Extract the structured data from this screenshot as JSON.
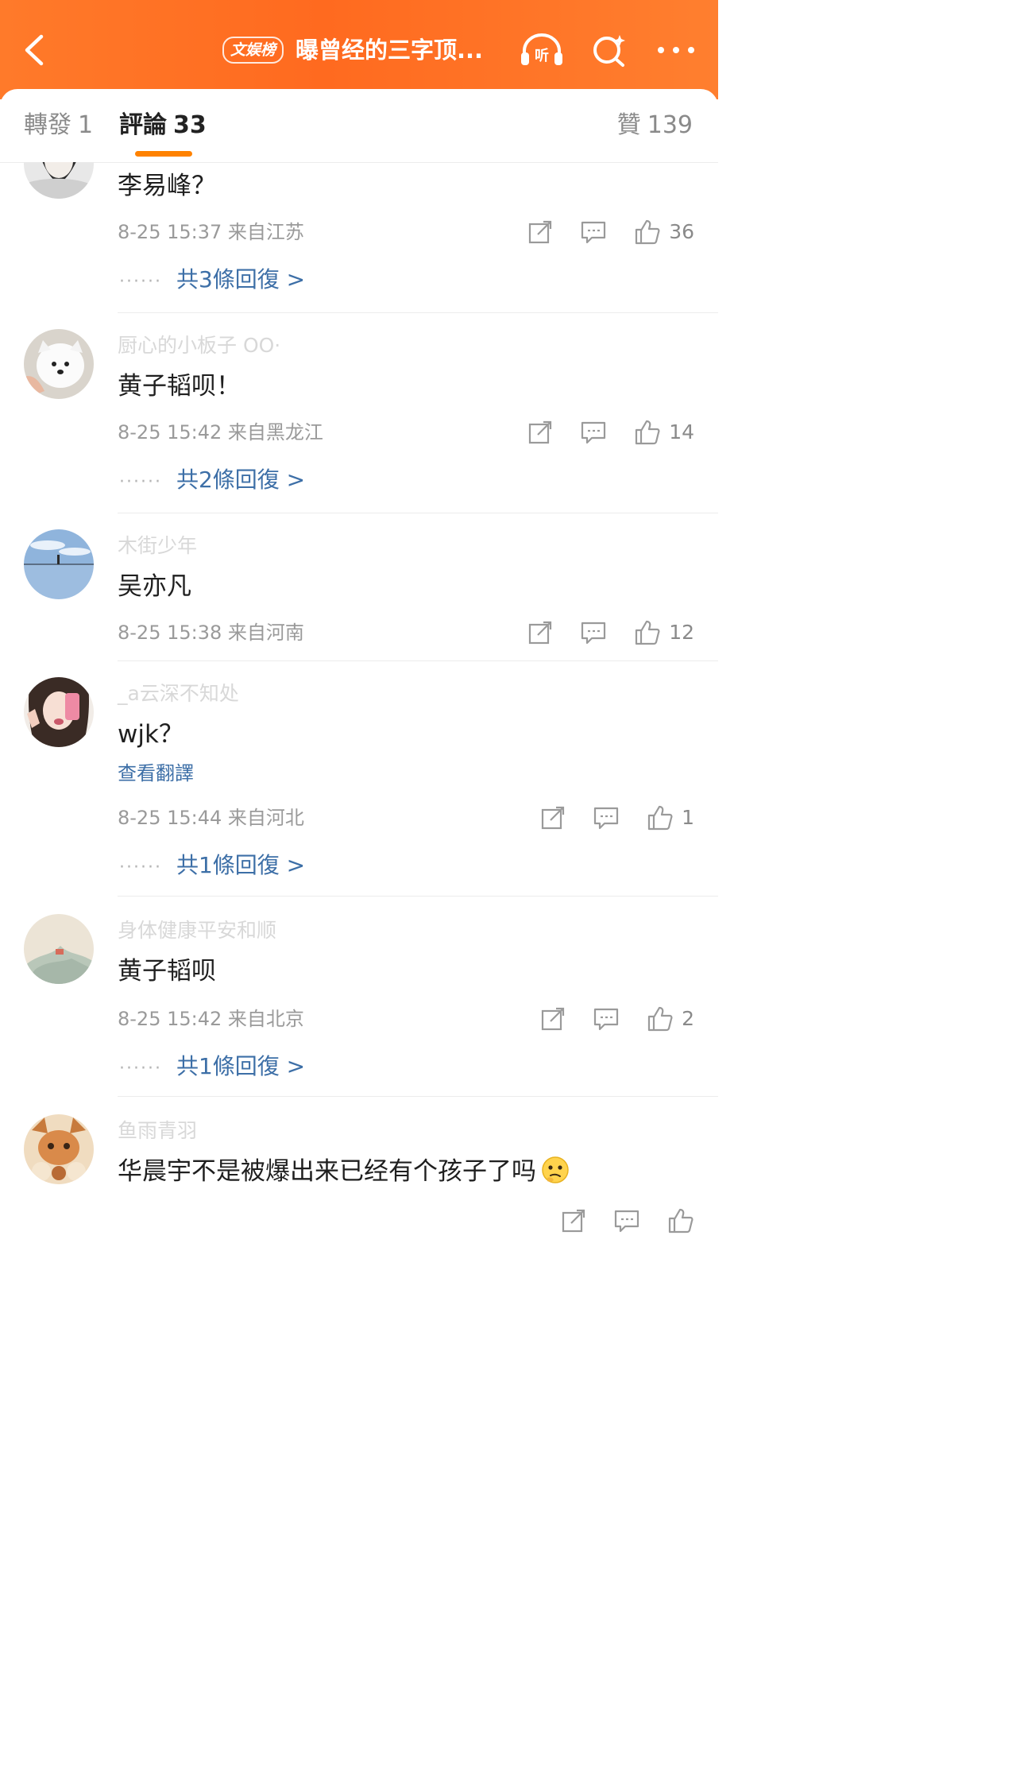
{
  "header": {
    "tag": "文娱榜",
    "title": "曝曾经的三字顶...",
    "listen_label": "听",
    "accent": "#ff7a2a"
  },
  "tabs": {
    "repost_label": "轉發",
    "repost_count": "1",
    "comments_label": "評論",
    "comments_count": "33",
    "likes_label": "贊",
    "likes_count": "139",
    "indicator_color": "#ff8200"
  },
  "comments": [
    {
      "username": "",
      "text": "李易峰？",
      "time": "8-25 15:37",
      "location": "来自江苏",
      "likes": "36",
      "replies": "共3條回復 >"
    },
    {
      "username": "厨心的小板子 OO·",
      "text": "黄子韬呗！",
      "time": "8-25 15:42",
      "location": "来自黑龙江",
      "likes": "14",
      "replies": "共2條回復 >"
    },
    {
      "username": "木街少年",
      "text": "吴亦凡",
      "time": "8-25 15:38",
      "location": "来自河南",
      "likes": "12",
      "replies": ""
    },
    {
      "username": "_a云深不知处",
      "text": "wjk？",
      "translate": "查看翻譯",
      "time": "8-25 15:44",
      "location": "来自河北",
      "likes": "1",
      "replies": "共1條回復 >"
    },
    {
      "username": "身体健康平安和顺",
      "text": "黄子韬呗",
      "time": "8-25 15:42",
      "location": "来自北京",
      "likes": "2",
      "replies": "共1條回復 >"
    },
    {
      "username": "鱼雨青羽",
      "text": "华晨宇不是被爆出来已经有个孩子了吗",
      "time": "",
      "location": "",
      "likes": "",
      "replies": ""
    }
  ],
  "icons": {
    "back": "chevron-left-icon",
    "listen": "headphones-icon",
    "search": "search-sparkle-icon",
    "more": "more-dots-icon",
    "share": "share-icon",
    "reply": "comment-icon",
    "like": "thumbs-up-icon",
    "emoji": "thinking-face-emoji"
  }
}
